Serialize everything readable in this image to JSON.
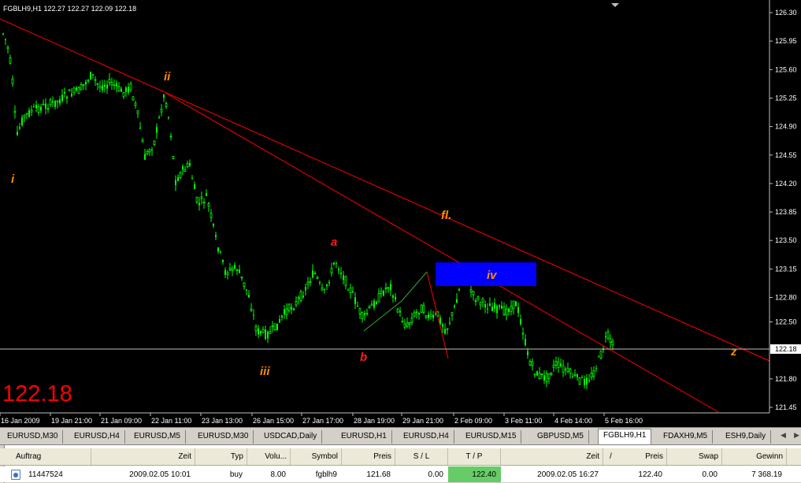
{
  "chart": {
    "symbol_info": "FGBLH9,H1  122.27  122.27  122.09  122.18",
    "big_price": "122.18",
    "current_price_label": "122.18",
    "price_axis": [
      "126.30",
      "125.95",
      "125.60",
      "125.25",
      "124.90",
      "124.55",
      "124.20",
      "123.85",
      "123.50",
      "123.15",
      "122.80",
      "122.50",
      "121.80",
      "121.45"
    ],
    "time_axis": [
      "16 Jan 2009",
      "19 Jan 21:00",
      "21 Jan 09:00",
      "22 Jan 11:00",
      "23 Jan 13:00",
      "26 Jan 15:00",
      "27 Jan 17:00",
      "28 Jan 19:00",
      "29 Jan 21:00",
      "2 Feb 09:00",
      "3 Feb 11:00",
      "4 Feb 14:00",
      "5 Feb 16:00"
    ],
    "annotations": {
      "i": "i",
      "ii": "ii",
      "iii": "iii",
      "iv": "iv",
      "a": "a",
      "b": "b",
      "fl": "fl.",
      "z": "z"
    },
    "colors": {
      "bull": "#00ff00",
      "bear": "#00ff00",
      "trendline": "#ff0000",
      "wave_orange": "#ff8c00",
      "wave_red": "#ff1a1a",
      "box": "#0000ff",
      "grid_line": "#c0c0c0"
    }
  },
  "tabs": [
    "EURUSD,M30",
    "EURUSD,H4",
    "EURUSD,M5",
    "EURUSD,M30",
    "USDCAD,Daily",
    "EURUSD,H1",
    "EURUSD,H4",
    "EURUSD,M15",
    "GBPUSD,M5",
    "FGBLH9,H1",
    "FDAXH9,M5",
    "ESH9,Daily"
  ],
  "active_tab": "FGBLH9,H1",
  "terminal": {
    "headers": [
      "Auftrag",
      "Zeit",
      "Typ",
      "Volu...",
      "Symbol",
      "Preis",
      "S / L",
      "T / P",
      "Zeit",
      "Preis",
      "Swap",
      "Gewinn"
    ],
    "sort_indicator": "/",
    "row": {
      "order": "11447524",
      "time_open": "2009.02.05 10:01",
      "type": "buy",
      "volume": "8.00",
      "symbol": "fgblh9",
      "price_open": "121.68",
      "sl": "0.00",
      "tp": "122.40",
      "time_close": "2009.02.05 16:27",
      "price_close": "122.40",
      "swap": "0.00",
      "profit": "7 368.19"
    }
  }
}
